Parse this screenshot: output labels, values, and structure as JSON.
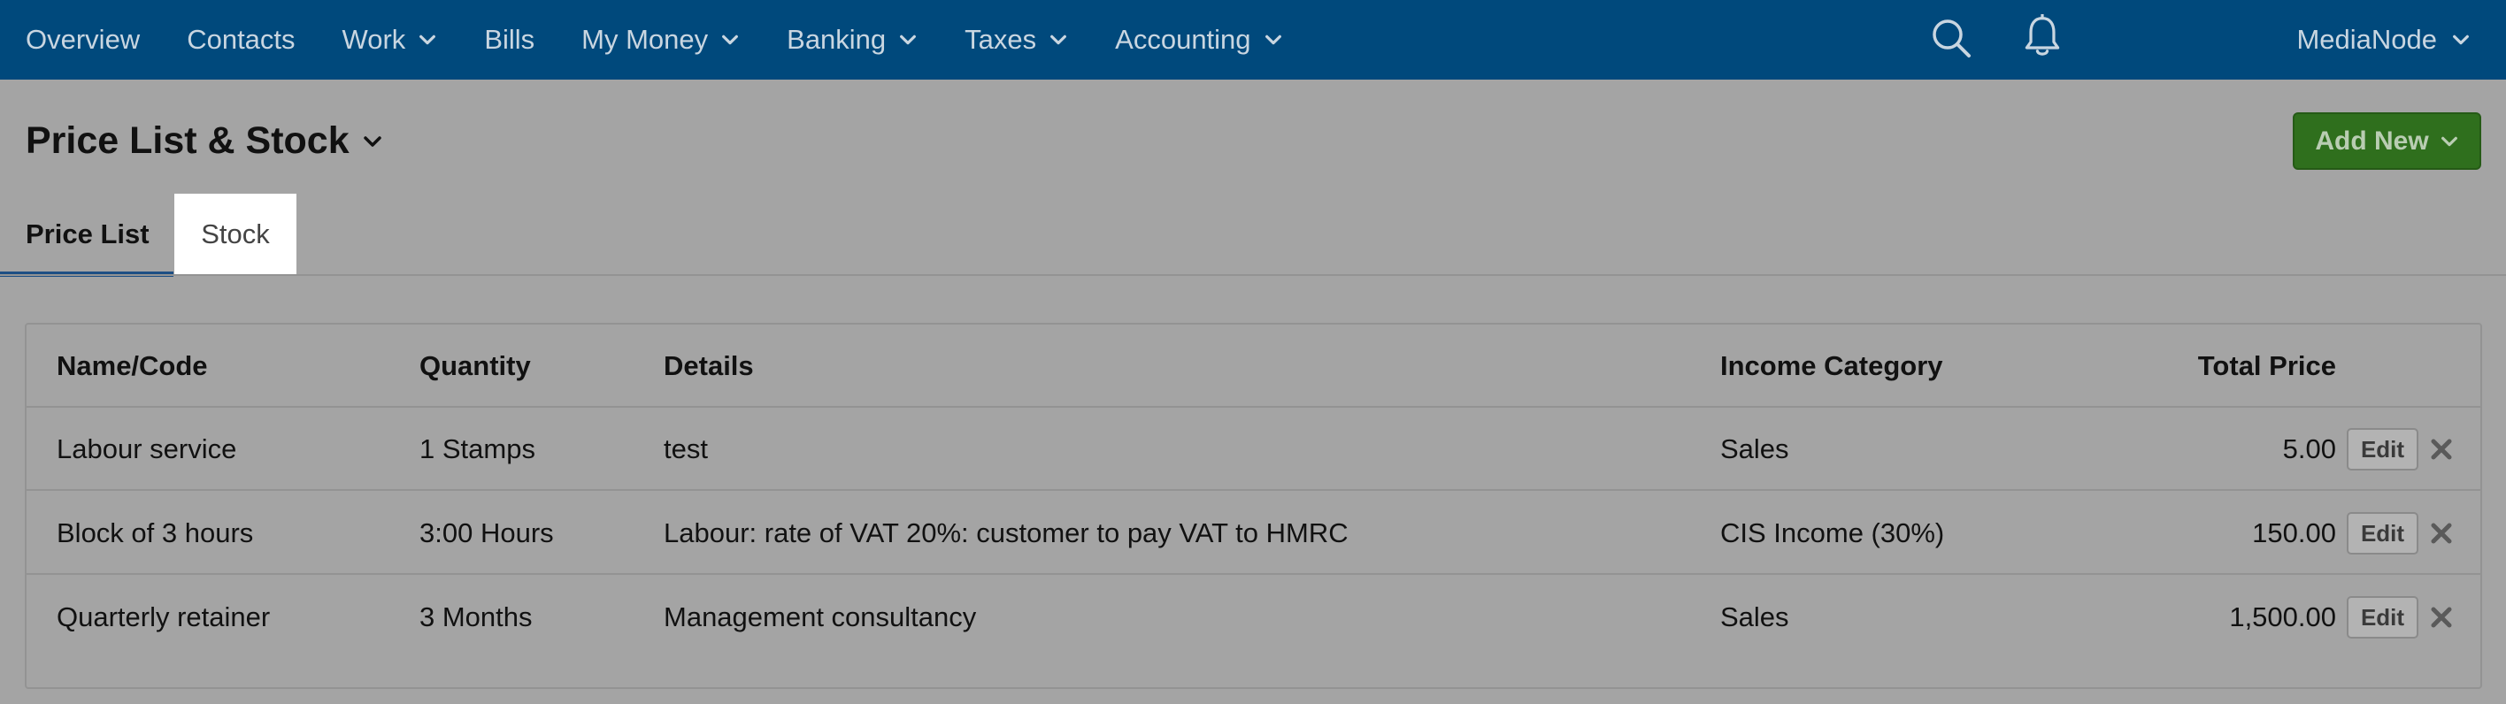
{
  "nav": {
    "items": [
      {
        "label": "Overview",
        "dropdown": false
      },
      {
        "label": "Contacts",
        "dropdown": false
      },
      {
        "label": "Work",
        "dropdown": true
      },
      {
        "label": "Bills",
        "dropdown": false
      },
      {
        "label": "My Money",
        "dropdown": true
      },
      {
        "label": "Banking",
        "dropdown": true
      },
      {
        "label": "Taxes",
        "dropdown": true
      },
      {
        "label": "Accounting",
        "dropdown": true
      }
    ],
    "search_icon": "search-icon",
    "notifications_icon": "bell-icon",
    "company_name": "MediaNode"
  },
  "page": {
    "title": "Price List & Stock",
    "add_new_label": "Add New"
  },
  "tabs": [
    {
      "label": "Price List",
      "active": true
    },
    {
      "label": "Stock",
      "active": false
    }
  ],
  "table": {
    "headers": {
      "name": "Name/Code",
      "quantity": "Quantity",
      "details": "Details",
      "income_category": "Income Category",
      "total_price": "Total Price"
    },
    "edit_label": "Edit",
    "rows": [
      {
        "name": "Labour service",
        "quantity": "1 Stamps",
        "details": "test",
        "income_category": "Sales",
        "total_price": "5.00"
      },
      {
        "name": "Block of 3 hours",
        "quantity": "3:00 Hours",
        "details": "Labour: rate of VAT 20%: customer to pay VAT to HMRC",
        "income_category": "CIS Income (30%)",
        "total_price": "150.00"
      },
      {
        "name": "Quarterly retainer",
        "quantity": "3 Months",
        "details": "Management consultancy",
        "income_category": "Sales",
        "total_price": "1,500.00"
      }
    ]
  },
  "colors": {
    "nav_bg": "#00497c",
    "page_bg": "#a4a4a4",
    "add_button": "#2f6f1d",
    "active_tab_underline": "#1e4f84"
  }
}
